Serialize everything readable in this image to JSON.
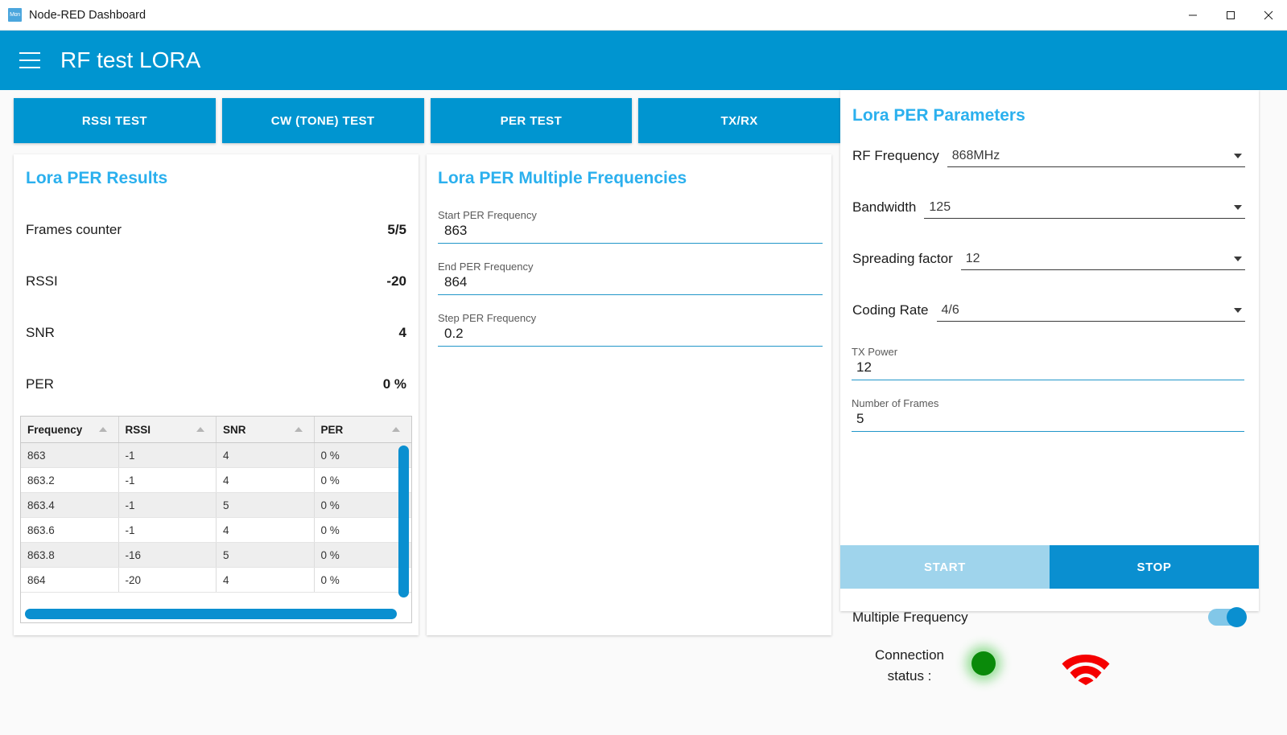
{
  "window": {
    "title": "Node-RED Dashboard",
    "favicon_label": "Mon",
    "minimize_icon": "minimize-icon",
    "maximize_icon": "maximize-icon",
    "close_icon": "close-icon"
  },
  "header": {
    "menu_icon": "hamburger-menu-icon",
    "app_title": "RF test LORA",
    "accent_color": "#0095d0"
  },
  "tabs": [
    {
      "label": "RSSI TEST"
    },
    {
      "label": "CW (TONE) TEST"
    },
    {
      "label": "PER TEST"
    },
    {
      "label": "TX/RX"
    }
  ],
  "results": {
    "title": "Lora PER Results",
    "title_color": "#2bb0ee",
    "metrics": [
      {
        "key": "Frames counter",
        "value": "5/5"
      },
      {
        "key": "RSSI",
        "value": "-20"
      },
      {
        "key": "SNR",
        "value": "4"
      },
      {
        "key": "PER",
        "value": "0 %"
      }
    ],
    "table": {
      "columns": [
        "Frequency",
        "RSSI",
        "SNR",
        "PER"
      ],
      "sort_icon": "sort-ascending-icon",
      "rows": [
        [
          "863",
          "-1",
          "4",
          "0 %"
        ],
        [
          "863.2",
          "-1",
          "4",
          "0 %"
        ],
        [
          "863.4",
          "-1",
          "5",
          "0 %"
        ],
        [
          "863.6",
          "-1",
          "4",
          "0 %"
        ],
        [
          "863.8",
          "-16",
          "5",
          "0 %"
        ],
        [
          "864",
          "-20",
          "4",
          "0 %"
        ]
      ],
      "scrollbar_color": "#0a8fd0"
    }
  },
  "multifreq": {
    "title": "Lora PER Multiple Frequencies",
    "fields": [
      {
        "label": "Start PER Frequency",
        "value": "863"
      },
      {
        "label": "End PER Frequency",
        "value": "864"
      },
      {
        "label": "Step PER Frequency",
        "value": "0.2"
      }
    ]
  },
  "parameters": {
    "title": "Lora PER Parameters",
    "selects": [
      {
        "label": "RF Frequency",
        "value": "868MHz",
        "icon": "chevron-down-icon"
      },
      {
        "label": "Bandwidth",
        "value": "125",
        "icon": "chevron-down-icon"
      },
      {
        "label": "Spreading factor",
        "value": "12",
        "icon": "chevron-down-icon"
      },
      {
        "label": "Coding Rate",
        "value": "4/6",
        "icon": "chevron-down-icon"
      }
    ],
    "inputs": [
      {
        "label": "TX Power",
        "value": "12"
      },
      {
        "label": "Number of Frames",
        "value": "5"
      }
    ],
    "buttons": {
      "start_label": "START",
      "stop_label": "STOP",
      "start_color": "#9fd4ec",
      "stop_color": "#0a8fd0"
    },
    "toggle": {
      "label": "Multiple Frequency",
      "state": "on",
      "color": "#0a8fd0"
    },
    "status": {
      "label": "Connection status :",
      "led_icon": "green-led-indicator",
      "led_color": "#0a8a0a",
      "wifi_icon": "wifi-icon",
      "wifi_color": "#f50000"
    }
  }
}
